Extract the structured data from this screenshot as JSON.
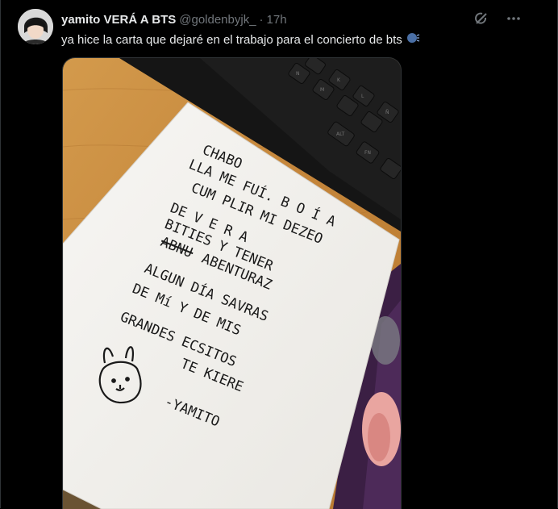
{
  "tweet": {
    "author_name": "yamito VERÁ A BTS",
    "handle": "@goldenbyjk_",
    "separator": "·",
    "time": "17h",
    "text": "ya hice la carta que dejaré en el trabajo para el concierto de bts",
    "emoji_icon": "speaking-head-icon"
  },
  "actions": {
    "grok_icon": "grok-icon",
    "more_icon": "more-icon"
  },
  "letter": {
    "lines": [
      "CHABO",
      "LLA ME FUÍ. B O Í A",
      "CUM PLIR MI DEZEO",
      "DE  V E R A",
      "BITIES  Y TENER",
      "ABNU",
      "ABENTURAZ",
      "ALGUN DÍA  SAVRAS",
      "DE  Mí  Y DE MIS",
      "GRANDES  ECSITOS",
      "TE  KIERE",
      "-YAMITO"
    ]
  },
  "keyboard": {
    "keys": [
      "N",
      "M",
      "K",
      "L",
      "Ñ",
      "ALT",
      "FN"
    ]
  },
  "colors": {
    "background": "#000000",
    "text_primary": "#e7e9ea",
    "text_secondary": "#71767b",
    "desk_wood": "#c88a3c",
    "paper": "#f4f3f0",
    "ink": "#1a1a1a"
  }
}
